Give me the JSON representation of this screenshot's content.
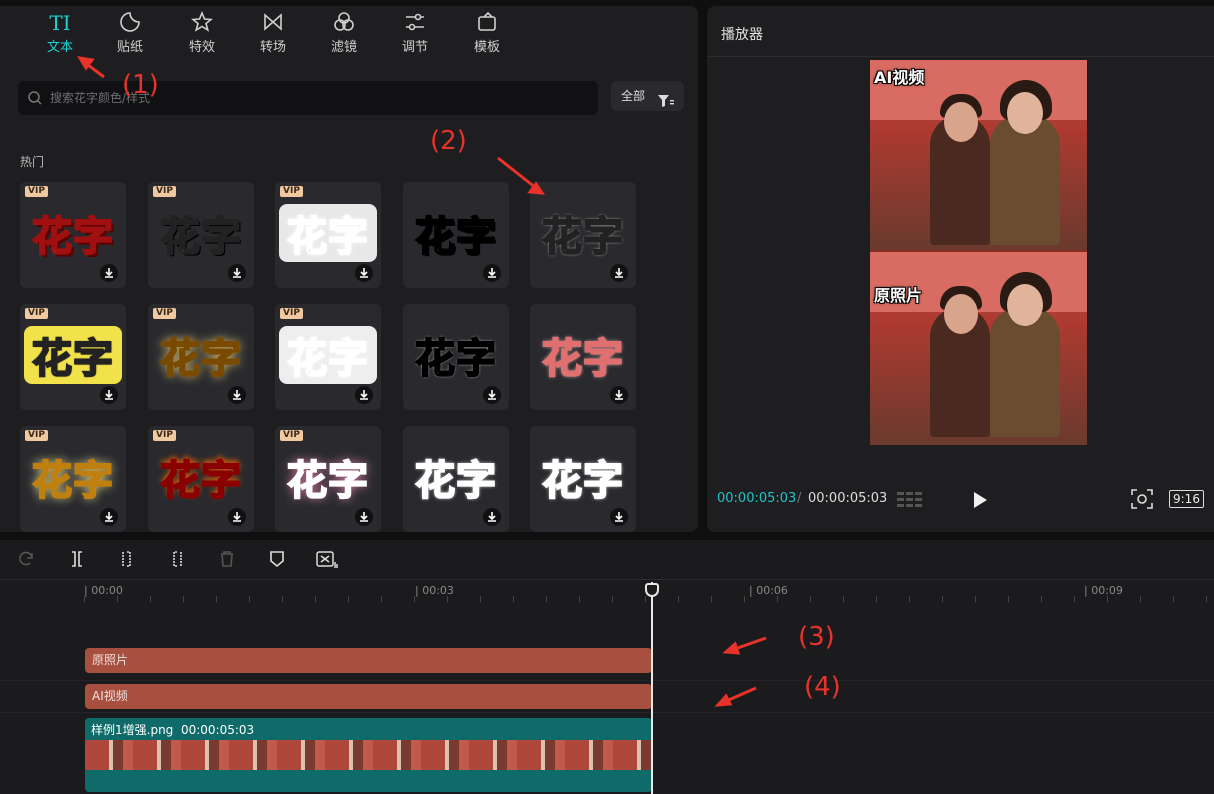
{
  "tabs": [
    {
      "label": "文本",
      "icon": "text-icon",
      "active": true
    },
    {
      "label": "贴纸",
      "icon": "sticker-icon"
    },
    {
      "label": "特效",
      "icon": "effects-icon"
    },
    {
      "label": "转场",
      "icon": "transition-icon"
    },
    {
      "label": "滤镜",
      "icon": "filter-icon"
    },
    {
      "label": "调节",
      "icon": "adjust-icon"
    },
    {
      "label": "模板",
      "icon": "template-icon"
    }
  ],
  "tab_icon_text": "TI",
  "search": {
    "placeholder": "搜索花字颜色/样式"
  },
  "filter": {
    "label": "全部"
  },
  "section": {
    "title": "热门"
  },
  "card_text": "花字",
  "vip_label": "VIP",
  "player": {
    "title": "播放器",
    "top_label": "AI视频",
    "bottom_label": "原照片",
    "time_current": "00:00:05:03",
    "time_sep": "/",
    "time_total": "00:00:05:03",
    "ratio": "9:16"
  },
  "timeline": {
    "ruler": [
      "| 00:00",
      "| 00:03",
      "| 00:06",
      "| 00:09"
    ],
    "clips": {
      "text1": "原照片",
      "text2": "AI视频",
      "video_name": "样例1增强.png",
      "video_duration": "00:00:05:03"
    }
  },
  "annotations": [
    "(1)",
    "(2)",
    "(3)",
    "(4)"
  ],
  "colors": {
    "accent": "#1fd0d3",
    "annotation": "#e8322a",
    "text_clip": "#a8503f",
    "video_clip": "#0f6a6a"
  }
}
